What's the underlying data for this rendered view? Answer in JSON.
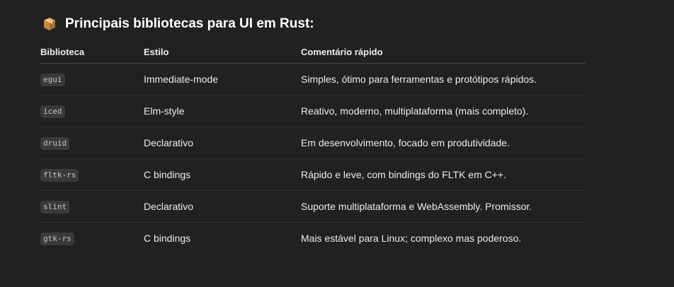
{
  "heading": {
    "icon": "package-icon",
    "text": "Principais bibliotecas para UI em Rust:"
  },
  "table": {
    "headers": [
      "Biblioteca",
      "Estilo",
      "Comentário rápido"
    ],
    "rows": [
      {
        "lib": "egui",
        "style": "Immediate-mode",
        "comment": "Simples, ótimo para ferramentas e protótipos rápidos."
      },
      {
        "lib": "iced",
        "style": "Elm-style",
        "comment": "Reativo, moderno, multiplataforma (mais completo)."
      },
      {
        "lib": "druid",
        "style": "Declarativo",
        "comment": "Em desenvolvimento, focado em produtividade."
      },
      {
        "lib": "fltk-rs",
        "style": "C bindings",
        "comment": "Rápido e leve, com bindings do FLTK em C++."
      },
      {
        "lib": "slint",
        "style": "Declarativo",
        "comment": "Suporte multiplataforma e WebAssembly. Promissor."
      },
      {
        "lib": "gtk-rs",
        "style": "C bindings",
        "comment": "Mais estável para Linux; complexo mas poderoso."
      }
    ]
  },
  "colors": {
    "background": "#212121",
    "text": "#ececec",
    "code_bg": "#3a3a3a",
    "code_text": "#b9c6d8"
  }
}
